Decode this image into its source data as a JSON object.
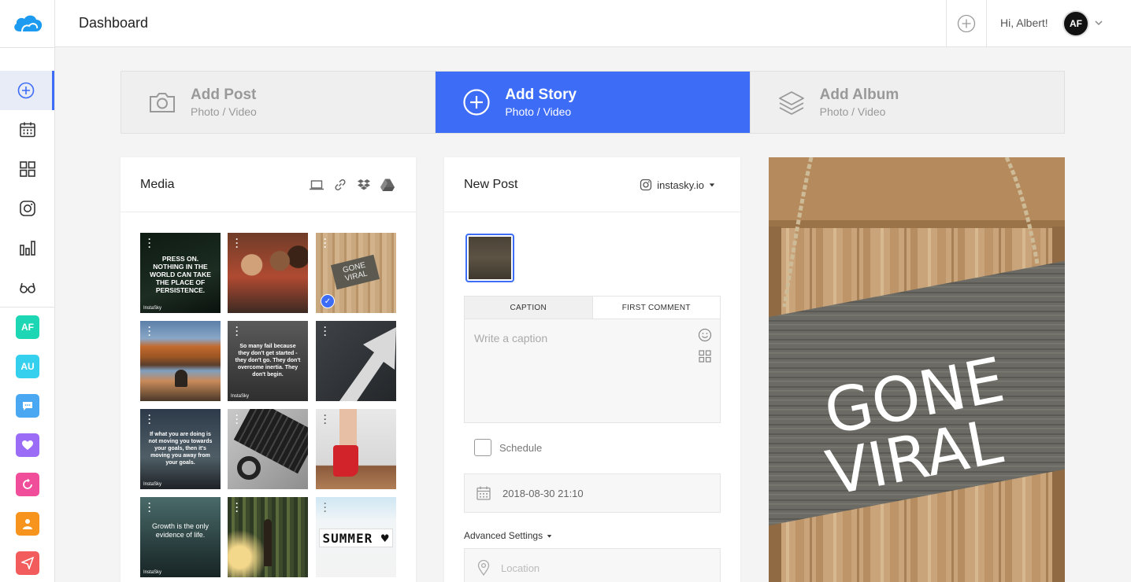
{
  "header": {
    "page_title": "Dashboard",
    "greeting": "Hi, Albert!",
    "avatar_initials": "AF"
  },
  "sidebar": {
    "nav": [
      {
        "icon": "plus-circle-icon",
        "active": true
      },
      {
        "icon": "calendar-icon",
        "active": false
      },
      {
        "icon": "grid-icon",
        "active": false
      },
      {
        "icon": "instagram-icon",
        "active": false
      },
      {
        "icon": "bar-chart-icon",
        "active": false
      },
      {
        "icon": "glasses-icon",
        "active": false
      }
    ],
    "accounts": [
      {
        "label": "AF",
        "color": "#1cd6b4"
      },
      {
        "label": "AU",
        "color": "#35d0ee"
      },
      {
        "icon": "chat-icon",
        "color": "#4aa8f2"
      },
      {
        "icon": "heart-icon",
        "color": "#9b6cf6"
      },
      {
        "icon": "refresh-icon",
        "color": "#f04e9a"
      },
      {
        "icon": "person-icon",
        "color": "#f7941d"
      },
      {
        "icon": "send-icon",
        "color": "#f25c5c"
      }
    ]
  },
  "post_types": [
    {
      "title": "Add Post",
      "subtitle": "Photo / Video",
      "icon": "camera-icon",
      "active": false
    },
    {
      "title": "Add Story",
      "subtitle": "Photo / Video",
      "icon": "plus-circle-icon",
      "active": true
    },
    {
      "title": "Add Album",
      "subtitle": "Photo / Video",
      "icon": "layers-icon",
      "active": false
    }
  ],
  "media": {
    "title": "Media",
    "source_icons": [
      "laptop-icon",
      "link-icon",
      "dropbox-icon",
      "google-drive-icon"
    ],
    "thumbnails": [
      {
        "text": "PRESS ON. NOTHING IN THE WORLD CAN TAKE THE PLACE OF PERSISTENCE.",
        "brand": "InstaSky",
        "selected": false
      },
      {
        "text": "",
        "brand": "",
        "selected": false
      },
      {
        "text": "GONE VIRAL",
        "brand": "",
        "selected": true
      },
      {
        "text": "",
        "brand": "",
        "selected": false
      },
      {
        "text": "So many fail because they don't get started - they don't go. They don't overcome inertia. They don't begin.",
        "brand": "InstaSky",
        "selected": false
      },
      {
        "text": "",
        "brand": "",
        "selected": false
      },
      {
        "text": "If what you are doing is not moving you towards your goals, then it's moving you away from your goals.",
        "brand": "InstaSky",
        "selected": false
      },
      {
        "text": "",
        "brand": "",
        "selected": false
      },
      {
        "text": "",
        "brand": "",
        "selected": false
      },
      {
        "text": "Growth is the only evidence of life.",
        "brand": "InstaSky",
        "selected": false
      },
      {
        "text": "",
        "brand": "",
        "selected": false
      },
      {
        "text": "SUMMER ♥",
        "brand": "",
        "selected": false
      }
    ]
  },
  "new_post": {
    "title": "New Post",
    "account": "instasky.io",
    "caption_tab": "CAPTION",
    "first_comment_tab": "FIRST COMMENT",
    "caption_placeholder": "Write a caption",
    "schedule_label": "Schedule",
    "datetime": "2018-08-30 21:10",
    "advanced_label": "Advanced Settings",
    "location_placeholder": "Location"
  },
  "preview": {
    "line1": "GONE",
    "line2": "VIRAL"
  },
  "colors": {
    "accent": "#3d6cf6"
  }
}
